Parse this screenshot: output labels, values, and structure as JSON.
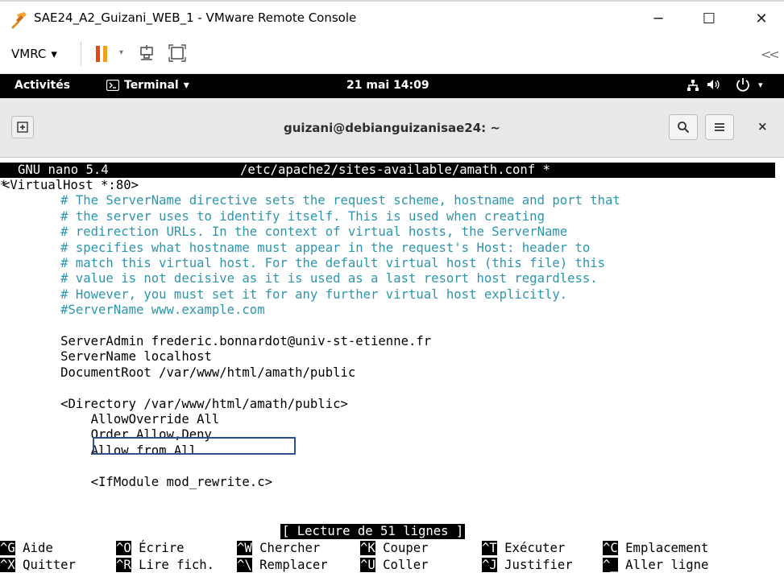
{
  "window": {
    "title": "SAE24_A2_Guizani_WEB_1 - VMware Remote Console",
    "minimize": "─",
    "maximize": "☐",
    "close": "✕"
  },
  "toolbar": {
    "menu_label": "VMRC",
    "menu_arrow": "▾",
    "pause_dropdown": "▾",
    "collapse": "<<"
  },
  "gnome": {
    "activities": "Activités",
    "app_menu": "Terminal",
    "app_menu_arrow": "▾",
    "clock": "21 mai 14:09",
    "power_arrow": "▾"
  },
  "terminal": {
    "title": "guizani@debianguizanisae24: ~",
    "close": "×"
  },
  "nano": {
    "version": "GNU nano 5.4",
    "file": "/etc/apache2/sites-available/amath.conf *",
    "marker": "*",
    "lines": [
      {
        "text": "<VirtualHost *:80>",
        "comment": false
      },
      {
        "text": "        # The ServerName directive sets the request scheme, hostname and port that",
        "comment": true
      },
      {
        "text": "        # the server uses to identify itself. This is used when creating",
        "comment": true
      },
      {
        "text": "        # redirection URLs. In the context of virtual hosts, the ServerName",
        "comment": true
      },
      {
        "text": "        # specifies what hostname must appear in the request's Host: header to",
        "comment": true
      },
      {
        "text": "        # match this virtual host. For the default virtual host (this file) this",
        "comment": true
      },
      {
        "text": "        # value is not decisive as it is used as a last resort host regardless.",
        "comment": true
      },
      {
        "text": "        # However, you must set it for any further virtual host explicitly.",
        "comment": true
      },
      {
        "text": "        #ServerName www.example.com",
        "comment": true
      },
      {
        "text": "",
        "comment": false
      },
      {
        "text": "        ServerAdmin frederic.bonnardot@univ-st-etienne.fr",
        "comment": false
      },
      {
        "text": "        ServerName localhost",
        "comment": false
      },
      {
        "text": "        DocumentRoot /var/www/html/amath/public",
        "comment": false
      },
      {
        "text": "",
        "comment": false
      },
      {
        "text": "        <Directory /var/www/html/amath/public>",
        "comment": false
      },
      {
        "text": "            AllowOverride All",
        "comment": false
      },
      {
        "text": "            Order Allow,Deny",
        "comment": false
      },
      {
        "text": "            Allow from All",
        "comment": false
      },
      {
        "text": "",
        "comment": false
      },
      {
        "text": "            <IfModule mod_rewrite.c>",
        "comment": false
      }
    ],
    "status": "[ Lecture de 51 lignes ]",
    "shortcuts_row1": [
      {
        "key": "^G",
        "label": " Aide"
      },
      {
        "key": "^O",
        "label": " Écrire"
      },
      {
        "key": "^W",
        "label": " Chercher"
      },
      {
        "key": "^K",
        "label": " Couper"
      },
      {
        "key": "^T",
        "label": " Exécuter"
      },
      {
        "key": "^C",
        "label": " Emplacement"
      }
    ],
    "shortcuts_row2": [
      {
        "key": "^X",
        "label": " Quitter"
      },
      {
        "key": "^R",
        "label": " Lire fich."
      },
      {
        "key": "^\\",
        "label": " Remplacer"
      },
      {
        "key": "^U",
        "label": " Coller"
      },
      {
        "key": "^J",
        "label": " Justifier"
      },
      {
        "key": "^_",
        "label": " Aller ligne"
      }
    ]
  }
}
